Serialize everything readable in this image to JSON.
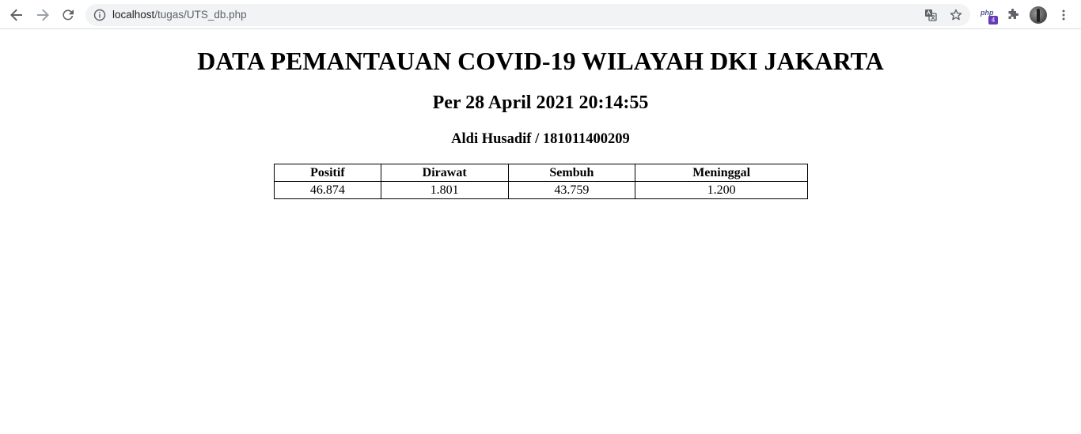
{
  "browser": {
    "url_host": "localhost",
    "url_path": "/tugas/UTS_db.php",
    "php_extension_label": "php",
    "php_extension_badge": "4"
  },
  "page": {
    "title": "DATA PEMANTAUAN COVID-19 WILAYAH DKI JAKARTA",
    "subtitle": "Per 28 April 2021 20:14:55",
    "author": "Aldi Husadif / 181011400209"
  },
  "table": {
    "headers": [
      "Positif",
      "Dirawat",
      "Sembuh",
      "Meninggal"
    ],
    "rows": [
      [
        "46.874",
        "1.801",
        "43.759",
        "1.200"
      ]
    ]
  },
  "icons": {
    "back": "arrow-left-icon",
    "forward": "arrow-right-icon",
    "reload": "reload-icon",
    "site_info": "info-icon",
    "translate": "translate-icon",
    "bookmark": "star-icon",
    "extensions": "puzzle-icon",
    "menu": "kebab-menu-icon"
  },
  "colors": {
    "toolbar_icon": "#5f6368",
    "omnibox_bg": "#f1f3f4",
    "php_badge": "#673ab7"
  }
}
